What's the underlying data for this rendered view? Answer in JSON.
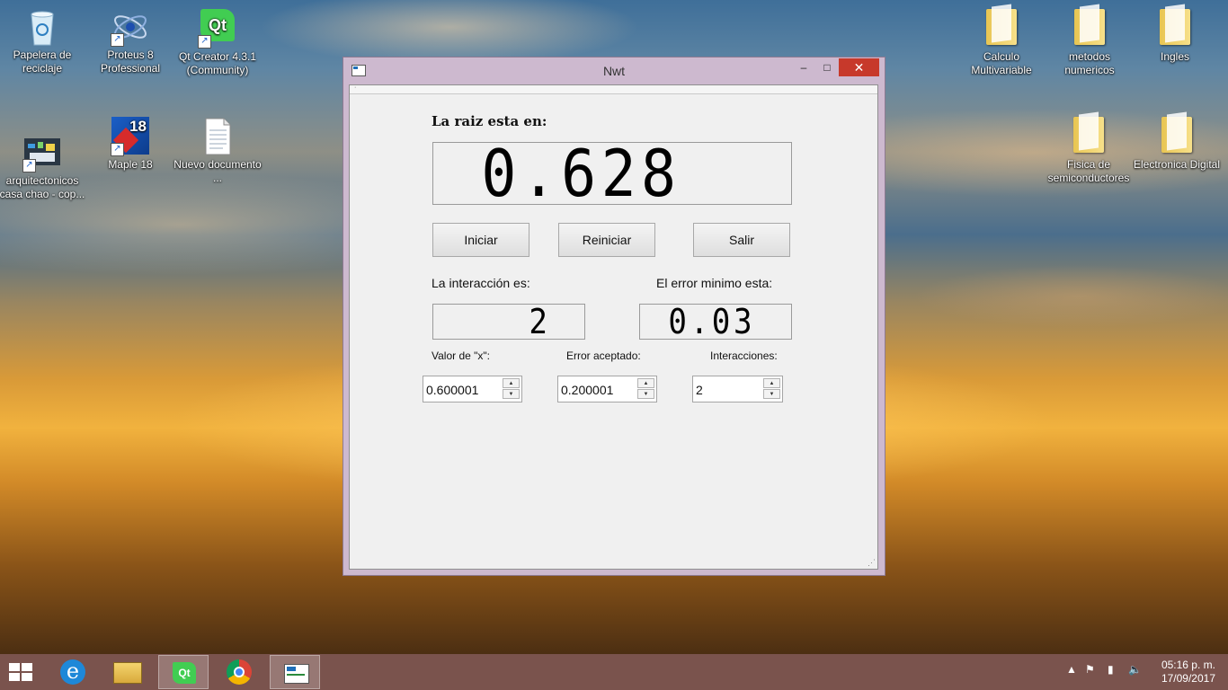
{
  "desktop": {
    "icons": [
      {
        "label": "Papelera de reciclaje",
        "icon": "recycle-bin-icon"
      },
      {
        "label": "Proteus 8 Professional",
        "icon": "proteus-icon"
      },
      {
        "label": "Qt Creator 4.3.1 (Community)",
        "icon": "qt-icon",
        "icon_text": "Qt"
      },
      {
        "label": "arquitectonicos casa chao - cop...",
        "icon": "app-shortcut-icon"
      },
      {
        "label": "Maple 18",
        "icon": "maple-icon",
        "icon_text": "18"
      },
      {
        "label": "Nuevo documento ...",
        "icon": "text-document-icon"
      },
      {
        "label": "Calculo Multivariable",
        "icon": "folder-icon"
      },
      {
        "label": "metodos numericos",
        "icon": "folder-icon"
      },
      {
        "label": "Ingles",
        "icon": "folder-icon"
      },
      {
        "label": "Fisica de semiconductores",
        "icon": "folder-icon"
      },
      {
        "label": "Electronica Digital",
        "icon": "folder-icon"
      }
    ]
  },
  "window": {
    "title": "Nwt",
    "controls": {
      "minimize": "–",
      "maximize": "□",
      "close": "✕"
    },
    "root_label": "La raiz esta en:",
    "root_value": "0.628",
    "buttons": {
      "start": "Iniciar",
      "reset": "Reiniciar",
      "exit": "Salir"
    },
    "iteration_label": "La interacción es:",
    "iteration_value": "2",
    "error_label": "El error minimo esta:",
    "error_value": "0.03",
    "x_label": "Valor de \"x\":",
    "x_value": "0.600001",
    "accepted_error_label": "Error aceptado:",
    "accepted_error_value": "0.200001",
    "iterations_label": "Interacciones:",
    "iterations_value": "2"
  },
  "taskbar": {
    "items": [
      "start-icon",
      "internet-explorer-icon",
      "file-explorer-icon",
      "qt-creator-icon",
      "chrome-icon",
      "nwt-app-icon"
    ],
    "qt_text": "Qt",
    "time": "05:16 p. m.",
    "date": "17/09/2017"
  },
  "colors": {
    "close_button": "#c7392b",
    "window_frame": "#cdb9cf",
    "taskbar": "#805854"
  }
}
